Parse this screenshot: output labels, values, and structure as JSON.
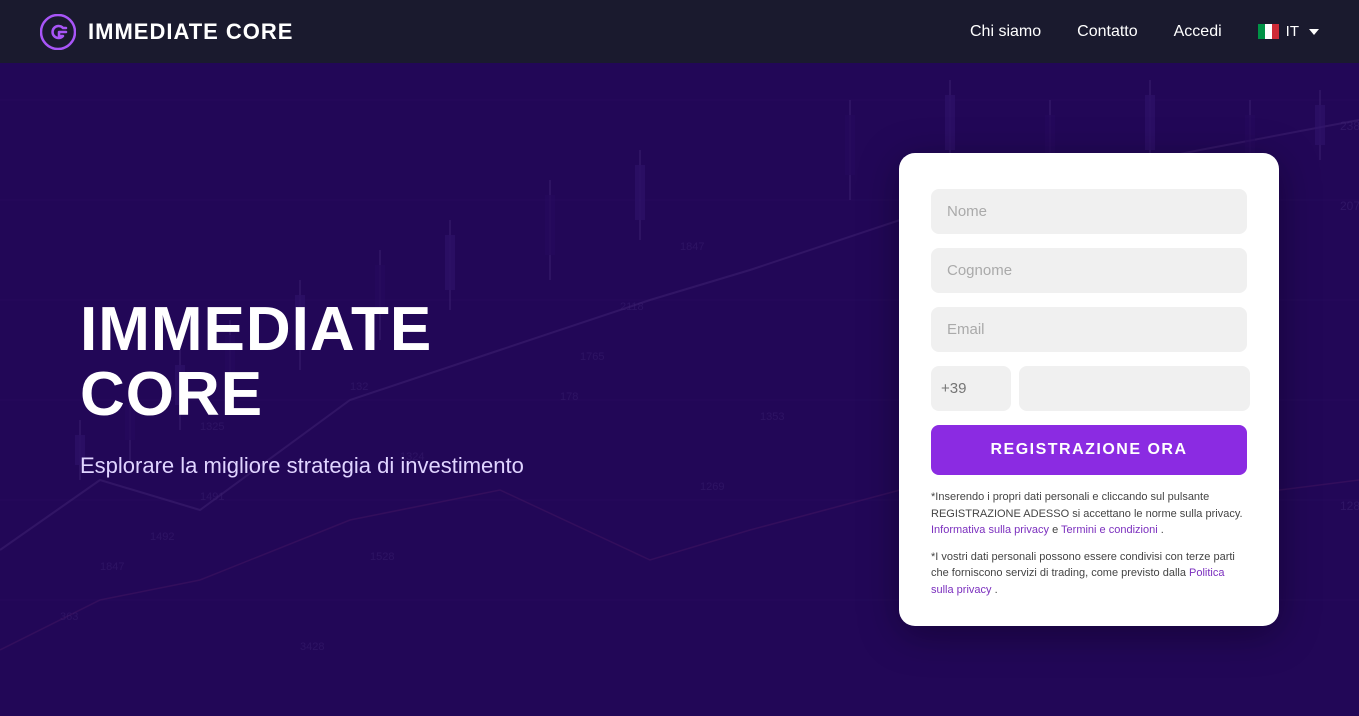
{
  "brand": {
    "name": "IMMEDIATE CORE"
  },
  "navbar": {
    "links": [
      {
        "label": "Chi siamo",
        "id": "chi-siamo"
      },
      {
        "label": "Contatto",
        "id": "contatto"
      },
      {
        "label": "Accedi",
        "id": "accedi"
      }
    ],
    "language": {
      "code": "IT",
      "flag": "italy"
    }
  },
  "hero": {
    "title": "IMMEDIATE CORE",
    "subtitle": "Esplorare la migliore strategia di investimento"
  },
  "form": {
    "fields": {
      "nome_placeholder": "Nome",
      "cognome_placeholder": "Cognome",
      "email_placeholder": "Email",
      "phone_prefix_placeholder": "+39",
      "phone_placeholder": ""
    },
    "submit_label": "REGISTRAZIONE ORA",
    "disclaimer1": "*Inserendo i propri dati personali e cliccando sul pulsante REGISTRAZIONE ADESSO si accettano le norme sulla privacy.",
    "disclaimer1_link1": "Informativa sulla privacy",
    "disclaimer1_and": "e",
    "disclaimer1_link2": "Termini e condizioni",
    "disclaimer1_dot": ".",
    "disclaimer2_prefix": "*I vostri dati personali possono essere condivisi con terze parti che forniscono servizi di trading, come previsto dalla",
    "disclaimer2_link": "Politica sulla privacy",
    "disclaimer2_suffix": "."
  }
}
